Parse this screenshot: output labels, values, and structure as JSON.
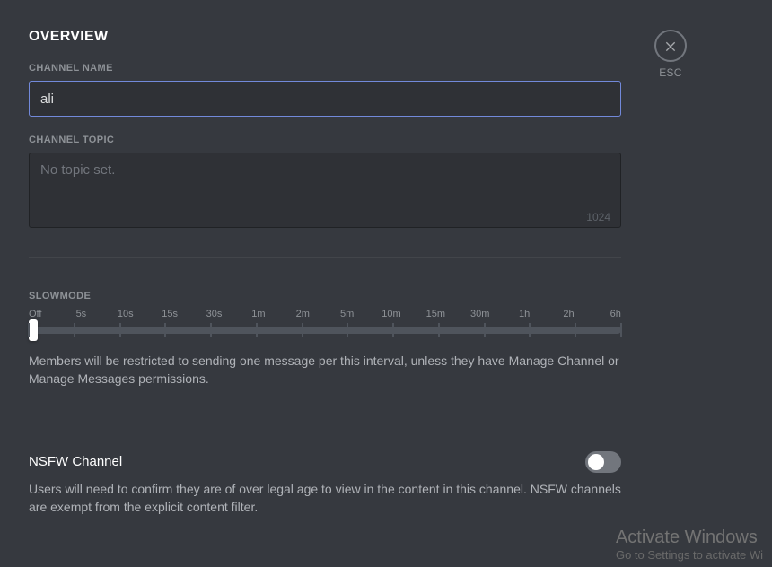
{
  "page_title": "OVERVIEW",
  "close_label": "ESC",
  "channel_name": {
    "label": "CHANNEL NAME",
    "value": "ali"
  },
  "channel_topic": {
    "label": "CHANNEL TOPIC",
    "placeholder": "No topic set.",
    "value": "",
    "char_limit": "1024"
  },
  "slowmode": {
    "label": "SLOWMODE",
    "ticks": [
      "Off",
      "5s",
      "10s",
      "15s",
      "30s",
      "1m",
      "2m",
      "5m",
      "10m",
      "15m",
      "30m",
      "1h",
      "2h",
      "6h"
    ],
    "description": "Members will be restricted to sending one message per this interval, unless they have Manage Channel or Manage Messages permissions."
  },
  "nsfw": {
    "title": "NSFW Channel",
    "description": "Users will need to confirm they are of over legal age to view in the content in this channel. NSFW channels are exempt from the explicit content filter.",
    "enabled": false
  },
  "watermark": {
    "line1": "Activate Windows",
    "line2": "Go to Settings to activate Wi"
  }
}
